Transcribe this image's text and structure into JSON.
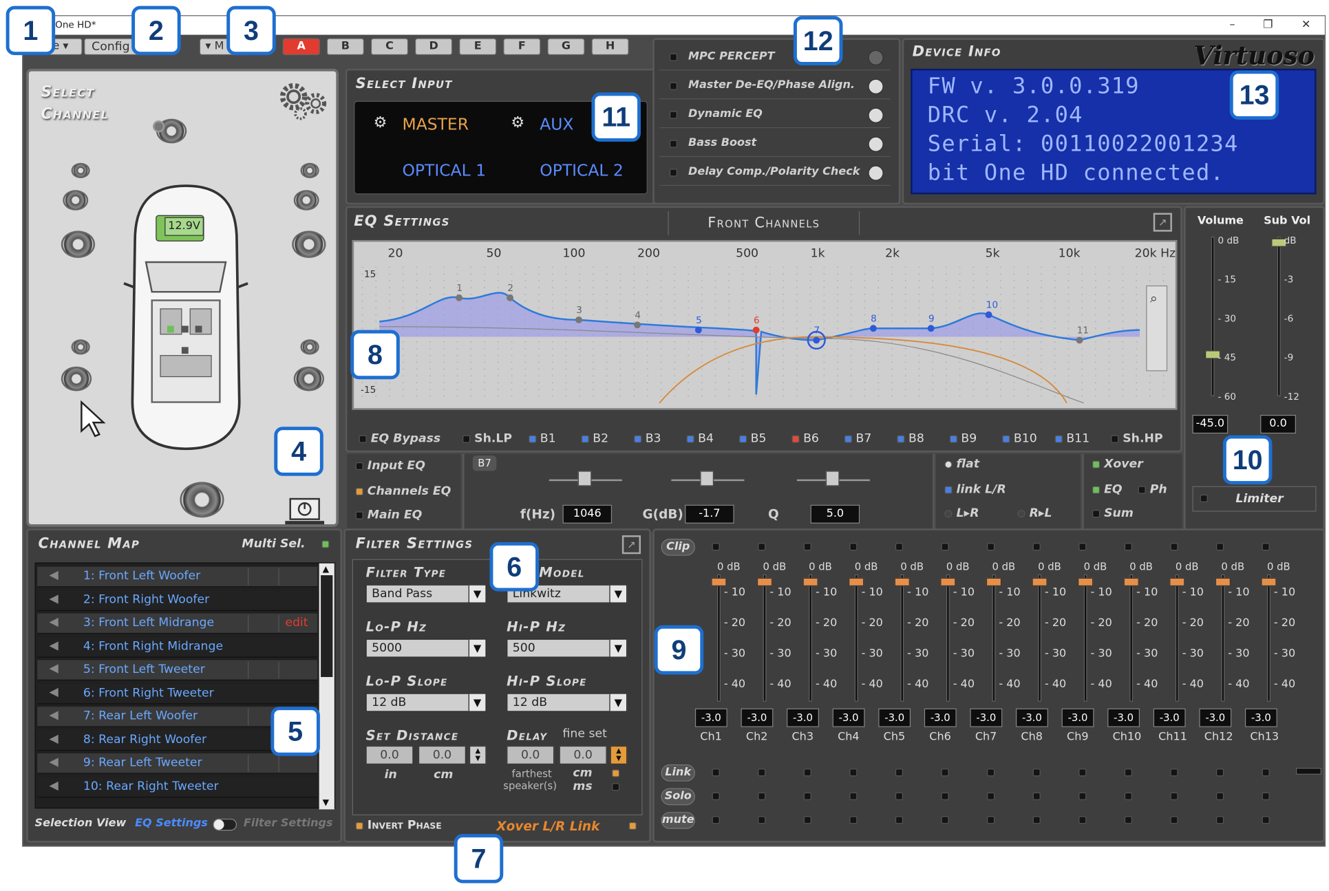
{
  "window": {
    "title": "One HD*",
    "minimize": "–",
    "restore": "❐",
    "close": "✕"
  },
  "toolbar": {
    "file_label": "e",
    "config_label": "Config",
    "mode_label": "M",
    "setups": [
      "A",
      "B",
      "C",
      "D",
      "E",
      "F",
      "G",
      "H"
    ],
    "active_setup": "A"
  },
  "select_channel": {
    "title_line1": "Select",
    "title_line2": "Channel",
    "battery": "12.9V"
  },
  "select_input": {
    "title": "Select Input",
    "master": "MASTER",
    "aux": "AUX",
    "optical1": "OPTICAL 1",
    "optical2": "OPTICAL 2"
  },
  "features": {
    "items": [
      "MPC  PERCEPT",
      "Master De-EQ/Phase Align.",
      "Dynamic EQ",
      "Bass Boost",
      "Delay Comp./Polarity Check"
    ]
  },
  "device_info": {
    "title": "Device Info",
    "brand": "Virtuoso",
    "lines": [
      "FW v. 3.0.0.319",
      "DRC v. 2.04",
      "Serial: 00110022001234",
      "bit One HD connected."
    ]
  },
  "eq": {
    "title": "EQ Settings",
    "channel_group": "Front Channels",
    "freq_labels": [
      "20",
      "50",
      "100",
      "200",
      "500",
      "1k",
      "2k",
      "5k",
      "10k",
      "20k Hz"
    ],
    "y_top": "15",
    "y_bottom": "-15",
    "bypass": "EQ Bypass",
    "shlp": "Sh.LP",
    "shhp": "Sh.HP",
    "bands": [
      "B1",
      "B2",
      "B3",
      "B4",
      "B5",
      "B6",
      "B7",
      "B8",
      "B9",
      "B10",
      "B11"
    ],
    "active_band": "B6",
    "points": [
      "1",
      "2",
      "3",
      "4",
      "5",
      "6",
      "7",
      "8",
      "9",
      "10",
      "11"
    ]
  },
  "eq_controls": {
    "input_eq": "Input EQ",
    "channels_eq": "Channels EQ",
    "main_eq": "Main EQ",
    "band_tag": "B7",
    "f_label": "f(Hz)",
    "f_value": "1046",
    "g_label": "G(dB)",
    "g_value": "-1.7",
    "q_label": "Q",
    "q_value": "5.0",
    "flat": "flat",
    "link_lr": "link L/R",
    "l_to_r": "L▸R",
    "r_to_l": "R▸L",
    "xover": "Xover",
    "eq": "EQ",
    "ph": "Ph",
    "sum": "Sum"
  },
  "volume": {
    "label": "Volume",
    "sub_label": "Sub Vol",
    "vol_ticks": [
      "0 dB",
      "- 15",
      "- 30",
      "- 45",
      "- 60"
    ],
    "sub_ticks": [
      "dB",
      "-3",
      "-6",
      "-9",
      "-12"
    ],
    "vol_value": "-45.0",
    "sub_value": "0.0",
    "limiter": "Limiter"
  },
  "channel_map": {
    "title": "Channel Map",
    "multi_sel": "Multi Sel.",
    "edit": "edit",
    "channels": [
      "1: Front Left Woofer",
      "2: Front Right Woofer",
      "3: Front Left Midrange",
      "4: Front Right Midrange",
      "5: Front Left Tweeter",
      "6: Front Right Tweeter",
      "7: Rear Left Woofer",
      "8: Rear Right Woofer",
      "9: Rear Left Tweeter",
      "10: Rear Right Tweeter"
    ],
    "selection_view": "Selection View",
    "eq_settings": "EQ Settings",
    "filter_settings": "Filter Settings"
  },
  "filter": {
    "title": "Filter Settings",
    "type_label": "Filter Type",
    "type_value": "Band Pass",
    "model_label": "r Model",
    "model_value": "Linkwitz",
    "lop_hz_label": "Lo-P  Hz",
    "lop_hz_value": "5000",
    "hip_hz_label": "Hi-P  Hz",
    "hip_hz_value": "500",
    "lop_slope_label": "Lo-P Slope",
    "lop_slope_value": "12 dB",
    "hip_slope_label": "Hi-P Slope",
    "hip_slope_value": "12 dB",
    "distance_label": "Set Distance",
    "dist_in": "0.0",
    "dist_cm": "0.0",
    "in": "in",
    "cm": "cm",
    "delay_label": "Delay",
    "fine_set": "fine set",
    "delay1": "0.0",
    "delay2": "0.0",
    "farthest": "farthest",
    "speakers": "speaker(s)",
    "cm2": "cm",
    "ms": "ms",
    "invert_phase": "Invert Phase",
    "xover_link": "Xover L/R Link"
  },
  "mixer": {
    "clip": "Clip",
    "link": "Link",
    "solo": "Solo",
    "mute": "mute",
    "db0": "0 dB",
    "scale": [
      "- 10",
      "- 20",
      "- 30",
      "- 40"
    ],
    "values": [
      "-3.0",
      "-3.0",
      "-3.0",
      "-3.0",
      "-3.0",
      "-3.0",
      "-3.0",
      "-3.0",
      "-3.0",
      "-3.0",
      "-3.0",
      "-3.0",
      "-3.0"
    ],
    "channels": [
      "Ch1",
      "Ch2",
      "Ch3",
      "Ch4",
      "Ch5",
      "Ch6",
      "Ch7",
      "Ch8",
      "Ch9",
      "Ch10",
      "Ch11",
      "Ch12",
      "Ch13"
    ]
  },
  "callouts": [
    "1",
    "2",
    "3",
    "4",
    "5",
    "6",
    "7",
    "8",
    "9",
    "10",
    "11",
    "12",
    "13"
  ],
  "colors": {
    "accent_blue": "#1e6fd0",
    "eq_fill": "#8f8ff0",
    "active_red": "#e23b2f",
    "lcd_bg": "#1530a8",
    "lcd_text": "#9fb6ff"
  }
}
